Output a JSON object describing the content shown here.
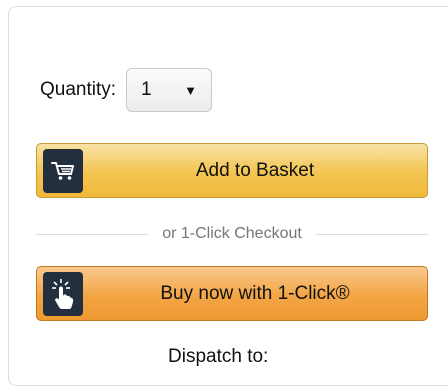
{
  "quantity": {
    "label": "Quantity:",
    "selected": "1"
  },
  "add_to_basket": {
    "label": "Add to Basket",
    "icon": "cart-icon"
  },
  "divider": {
    "text": "or 1-Click Checkout"
  },
  "buy_now": {
    "label": "Buy now with 1-Click®",
    "icon": "tap-hand-icon"
  },
  "cutoff_text": {
    "text": "Dispatch to:"
  },
  "colors": {
    "basket_button": "#f3c450",
    "buy_now_button": "#f3a545",
    "icon_background": "#232f3e"
  }
}
